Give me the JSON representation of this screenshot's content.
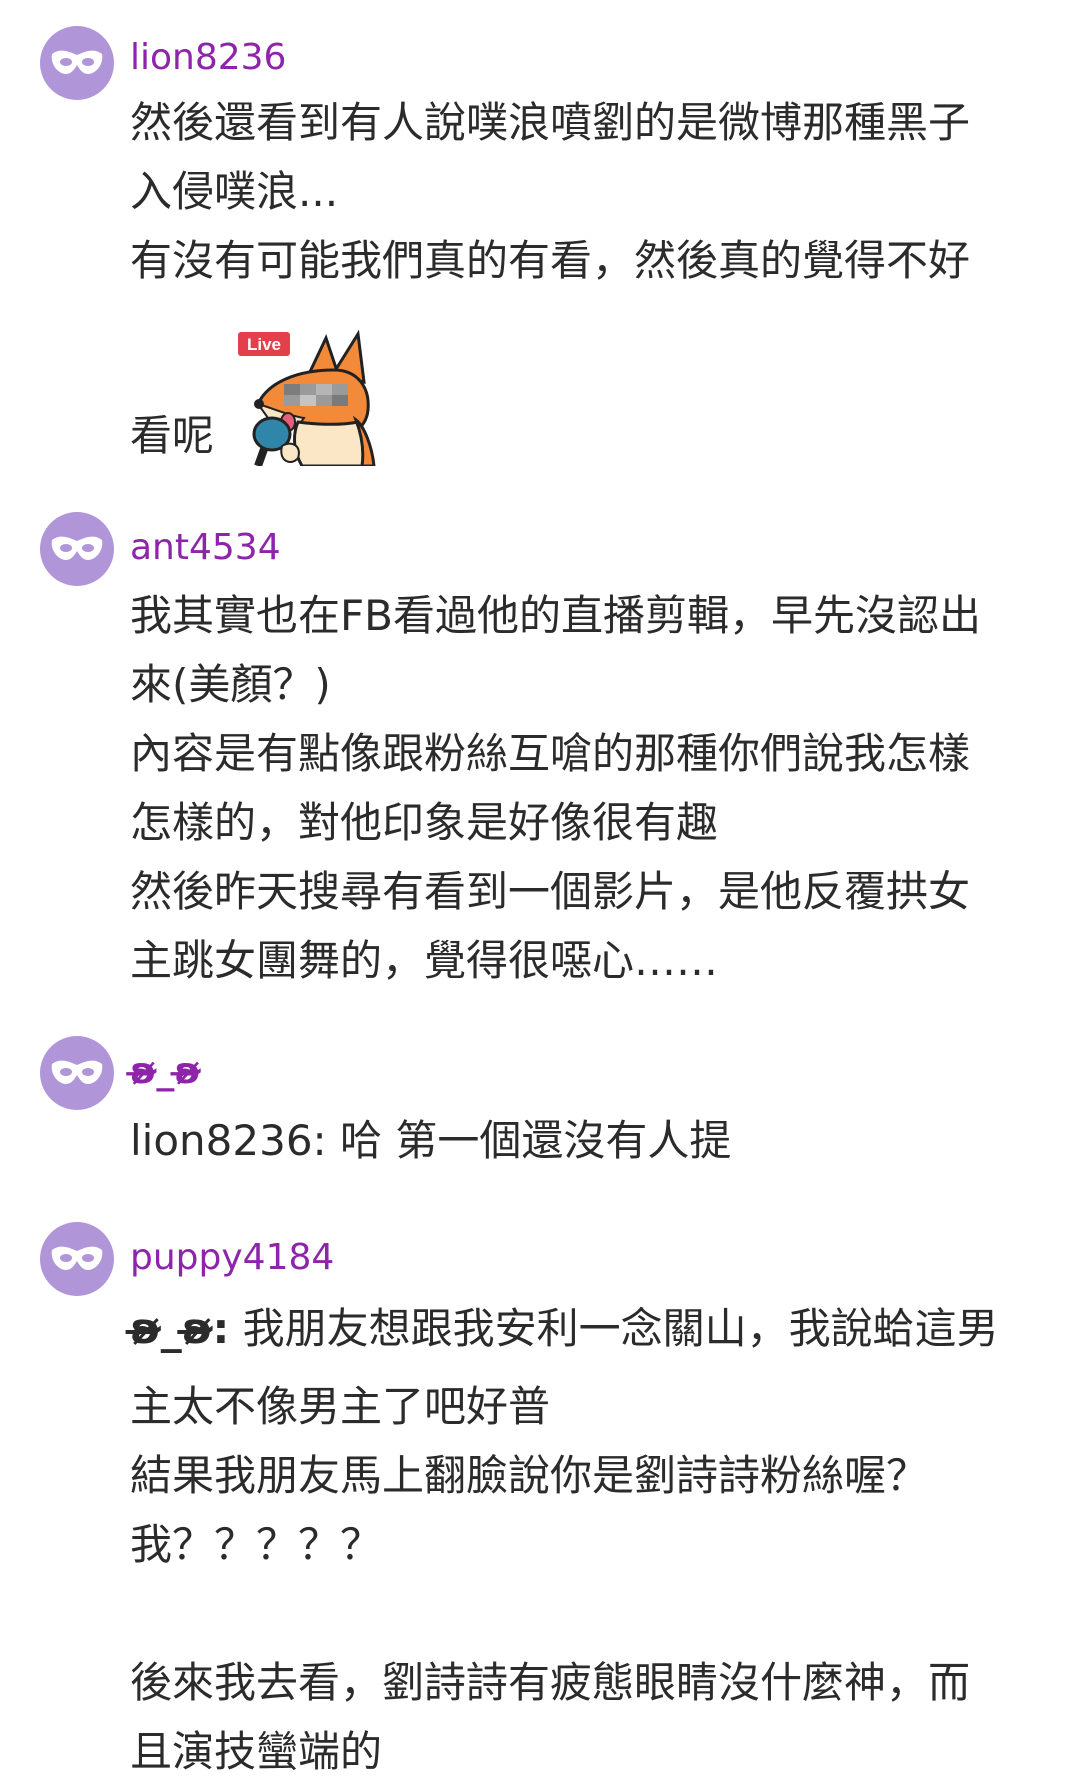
{
  "comments": [
    {
      "username": "lion8236",
      "lines": [
        "然後還看到有人說噗浪噴劉的是微博那種黑子",
        "入侵噗浪...",
        "有沒有可能我們真的有看，然後真的覺得不好"
      ],
      "last_line": "看呢",
      "sticker": {
        "badge": "Live",
        "icon": "fox-reporter-sticker"
      }
    },
    {
      "username": "ant4534",
      "lines": [
        "我其實也在FB看過他的直播剪輯，早先沒認出",
        "來(美顏？)",
        "內容是有點像跟粉絲互嗆的那種你們說我怎樣",
        "怎樣的，對他印象是好像很有趣",
        "然後昨天搜尋有看到一個影片，是他反覆拱女",
        "主跳女團舞的，覺得很噁心……"
      ]
    },
    {
      "username": "ʚ̴̶̷_ʚ̴̶̷",
      "mention": "lion8236:",
      "text": " 哈 第一個還沒有人提"
    },
    {
      "username": "puppy4184",
      "mention": "ʚ̴̶̷_ʚ̴̶̷:",
      "first_line": " 我朋友想跟我安利一念關山，我說蛤這男",
      "lines": [
        "主太不像男主了吧好普",
        "結果我朋友馬上翻臉說你是劉詩詩粉絲喔？",
        "我？？？？？",
        "",
        "後來我去看，劉詩詩有疲態眼睛沒什麼神，而",
        "且演技蠻端的"
      ]
    }
  ],
  "colors": {
    "username": "#8e24aa",
    "avatar_bg": "#b096d9",
    "text": "#2b2b2b"
  },
  "icons": {
    "avatar": "mask-icon"
  }
}
